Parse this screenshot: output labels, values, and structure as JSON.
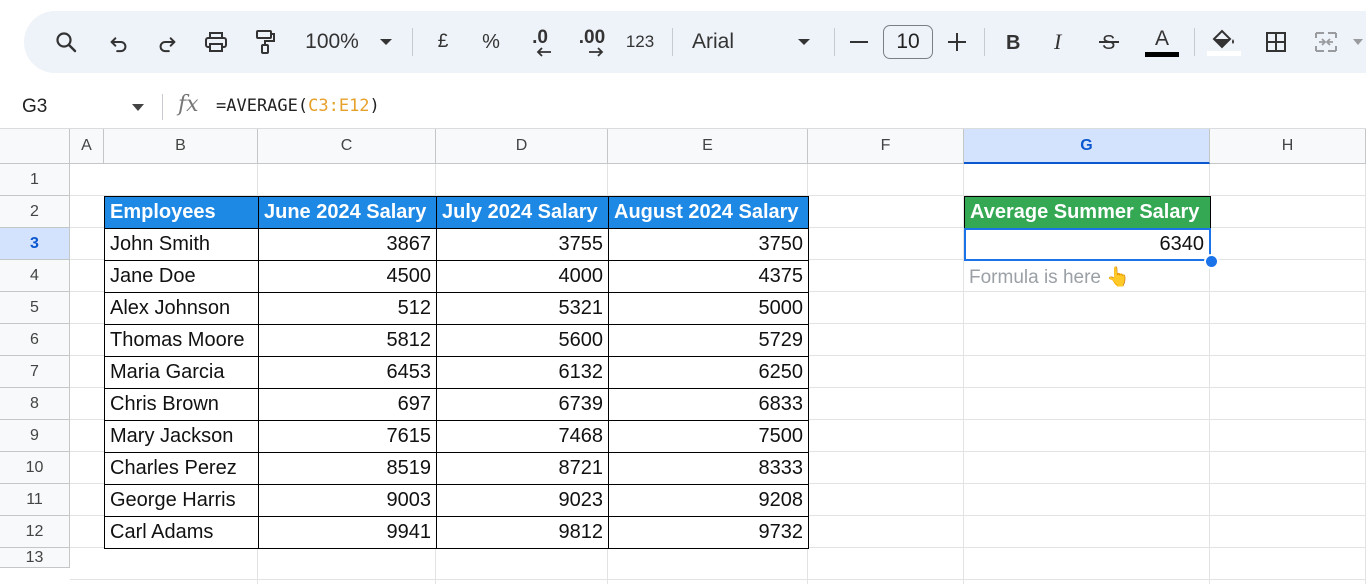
{
  "toolbar": {
    "zoom": "100%",
    "currency": "£",
    "percent": "%",
    "decrease_decimal": ".0",
    "increase_decimal": ".00",
    "number_format": "123",
    "font": "Arial",
    "font_size": "10",
    "text_color_letter": "A",
    "icons": [
      "search-icon",
      "undo-icon",
      "redo-icon",
      "print-icon",
      "paint-format-icon",
      "zoom-dropdown-icon",
      "font-dropdown-icon",
      "minus-icon",
      "plus-icon",
      "bold-icon",
      "italic-icon",
      "strikethrough-icon",
      "text-color-icon",
      "fill-color-icon",
      "borders-icon",
      "merge-cells-icon"
    ]
  },
  "formula_bar": {
    "cell_ref": "G3",
    "formula_prefix": "=AVERAGE(",
    "formula_range": "C3:E12",
    "formula_suffix": ")"
  },
  "columns": [
    "A",
    "B",
    "C",
    "D",
    "E",
    "F",
    "G",
    "H"
  ],
  "selected_column": "G",
  "rows": [
    "1",
    "2",
    "3",
    "4",
    "5",
    "6",
    "7",
    "8",
    "9",
    "10",
    "11",
    "12",
    "13"
  ],
  "selected_row": "3",
  "table": {
    "headers": [
      "Employees",
      "June 2024 Salary",
      "July 2024 Salary",
      "August 2024 Salary"
    ],
    "rows": [
      [
        "John Smith",
        "3867",
        "3755",
        "3750"
      ],
      [
        "Jane Doe",
        "4500",
        "4000",
        "4375"
      ],
      [
        "Alex Johnson",
        "512",
        "5321",
        "5000"
      ],
      [
        "Thomas Moore",
        "5812",
        "5600",
        "5729"
      ],
      [
        "Maria Garcia",
        "6453",
        "6132",
        "6250"
      ],
      [
        "Chris Brown",
        "697",
        "6739",
        "6833"
      ],
      [
        "Mary Jackson",
        "7615",
        "7468",
        "7500"
      ],
      [
        "Charles Perez",
        "8519",
        "8721",
        "8333"
      ],
      [
        "George Harris",
        "9003",
        "9023",
        "9208"
      ],
      [
        "Carl Adams",
        "9941",
        "9812",
        "9732"
      ]
    ]
  },
  "summary": {
    "header": "Average Summer Salary",
    "value": "6340",
    "note": "Formula is here 👆"
  },
  "colors": {
    "table_header": "#1e88e5",
    "summary_header": "#34a853",
    "selection": "#1a73e8",
    "formula_range": "#e6a12a"
  }
}
